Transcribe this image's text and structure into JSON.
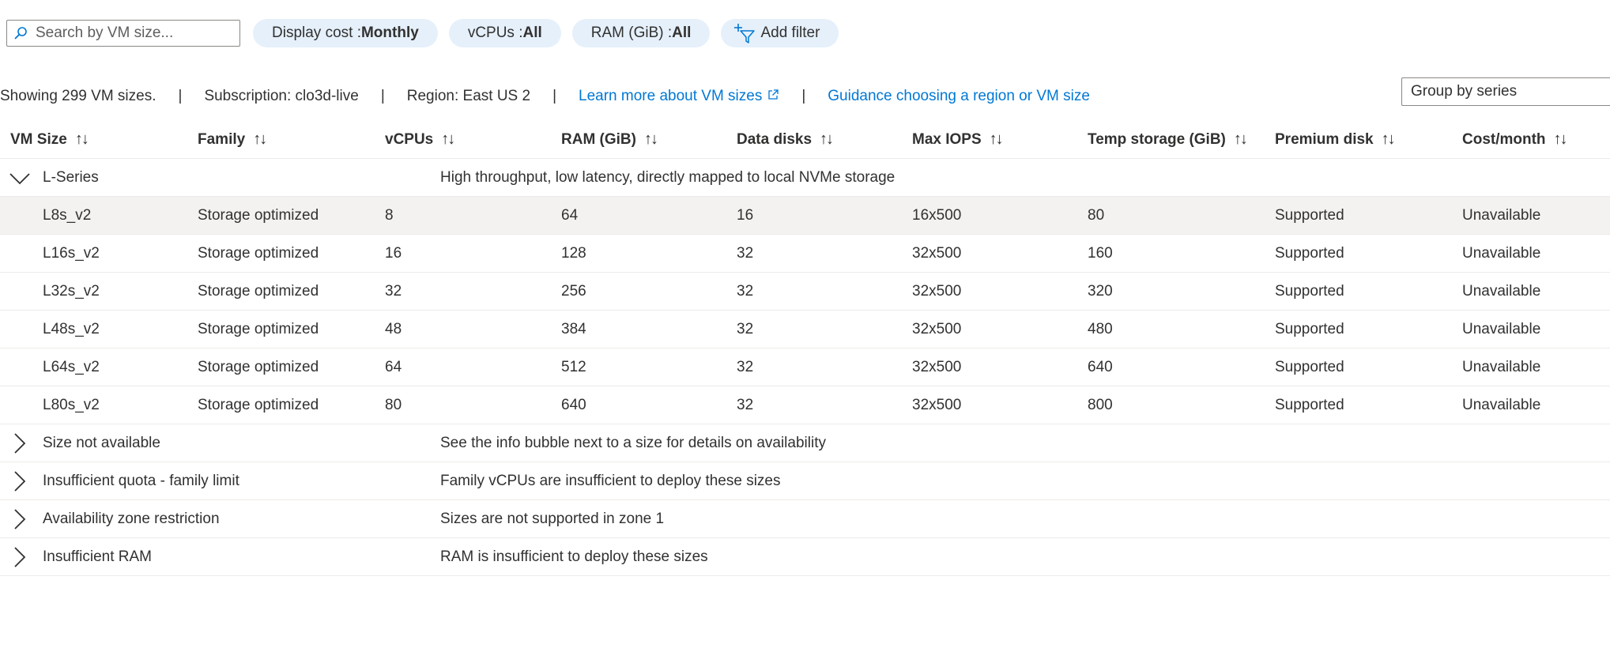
{
  "toolbar": {
    "search_placeholder": "Search by VM size...",
    "filters": [
      {
        "label": "Display cost : ",
        "value": "Monthly"
      },
      {
        "label": "vCPUs : ",
        "value": "All"
      },
      {
        "label": "RAM (GiB) : ",
        "value": "All"
      }
    ],
    "add_filter_label": "Add filter"
  },
  "info": {
    "showing": "Showing 299 VM sizes.",
    "subscription": "Subscription: clo3d-live",
    "region": "Region: East US 2",
    "learn_more": "Learn more about VM sizes",
    "guidance": "Guidance choosing a region or VM size",
    "separator": "|"
  },
  "group_by": "Group by series",
  "columns": [
    {
      "label": "VM Size",
      "sort": "↑↓"
    },
    {
      "label": "Family",
      "sort": "↑↓"
    },
    {
      "label": "vCPUs",
      "sort": "↑↓"
    },
    {
      "label": "RAM (GiB)",
      "sort": "↑↓"
    },
    {
      "label": "Data disks",
      "sort": "↑↓"
    },
    {
      "label": "Max IOPS",
      "sort": "↑↓"
    },
    {
      "label": "Temp storage (GiB)",
      "sort": "↑↓"
    },
    {
      "label": "Premium disk",
      "sort": "↑↓"
    },
    {
      "label": "Cost/month",
      "sort": "↑↓"
    }
  ],
  "series_group": {
    "name": "L-Series",
    "description": "High throughput, low latency, directly mapped to local NVMe storage",
    "expanded": true
  },
  "rows": [
    [
      "L8s_v2",
      "Storage optimized",
      "8",
      "64",
      "16",
      "16x500",
      "80",
      "Supported",
      "Unavailable"
    ],
    [
      "L16s_v2",
      "Storage optimized",
      "16",
      "128",
      "32",
      "32x500",
      "160",
      "Supported",
      "Unavailable"
    ],
    [
      "L32s_v2",
      "Storage optimized",
      "32",
      "256",
      "32",
      "32x500",
      "320",
      "Supported",
      "Unavailable"
    ],
    [
      "L48s_v2",
      "Storage optimized",
      "48",
      "384",
      "32",
      "32x500",
      "480",
      "Supported",
      "Unavailable"
    ],
    [
      "L64s_v2",
      "Storage optimized",
      "64",
      "512",
      "32",
      "32x500",
      "640",
      "Supported",
      "Unavailable"
    ],
    [
      "L80s_v2",
      "Storage optimized",
      "80",
      "640",
      "32",
      "32x500",
      "800",
      "Supported",
      "Unavailable"
    ]
  ],
  "collapsed_groups": [
    {
      "name": "Size not available",
      "description": "See the info bubble next to a size for details on availability"
    },
    {
      "name": "Insufficient quota - family limit",
      "description": "Family vCPUs are insufficient to deploy these sizes"
    },
    {
      "name": "Availability zone restriction",
      "description": "Sizes are not supported in zone 1"
    },
    {
      "name": "Insufficient RAM",
      "description": "RAM is insufficient to deploy these sizes"
    }
  ]
}
